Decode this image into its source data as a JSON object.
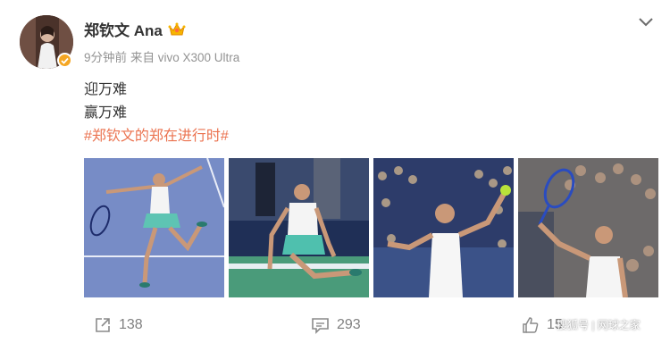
{
  "post": {
    "username": "郑钦文 Ana",
    "time_ago": "9分钟前",
    "source": "来自 vivo X300 Ultra",
    "lines": [
      "迎万难",
      "赢万难"
    ],
    "hashtag": "#郑钦文的郑在进行时#"
  },
  "icons": {
    "verified": "verified-badge-icon",
    "member": "crown-member-icon",
    "more": "chevron-down-icon",
    "repost": "repost-icon",
    "comment": "comment-icon",
    "like": "thumbs-up-icon"
  },
  "photos": [
    {
      "name": "photo-1"
    },
    {
      "name": "photo-2"
    },
    {
      "name": "photo-3"
    },
    {
      "name": "photo-4"
    }
  ],
  "actions": {
    "repost_count": "138",
    "comment_count": "293",
    "like_count": "15"
  },
  "watermark": "搜狐号 | 网球之家",
  "colors": {
    "hashtag": "#eb7350",
    "verified": "#f5a623",
    "meta": "#939393"
  }
}
